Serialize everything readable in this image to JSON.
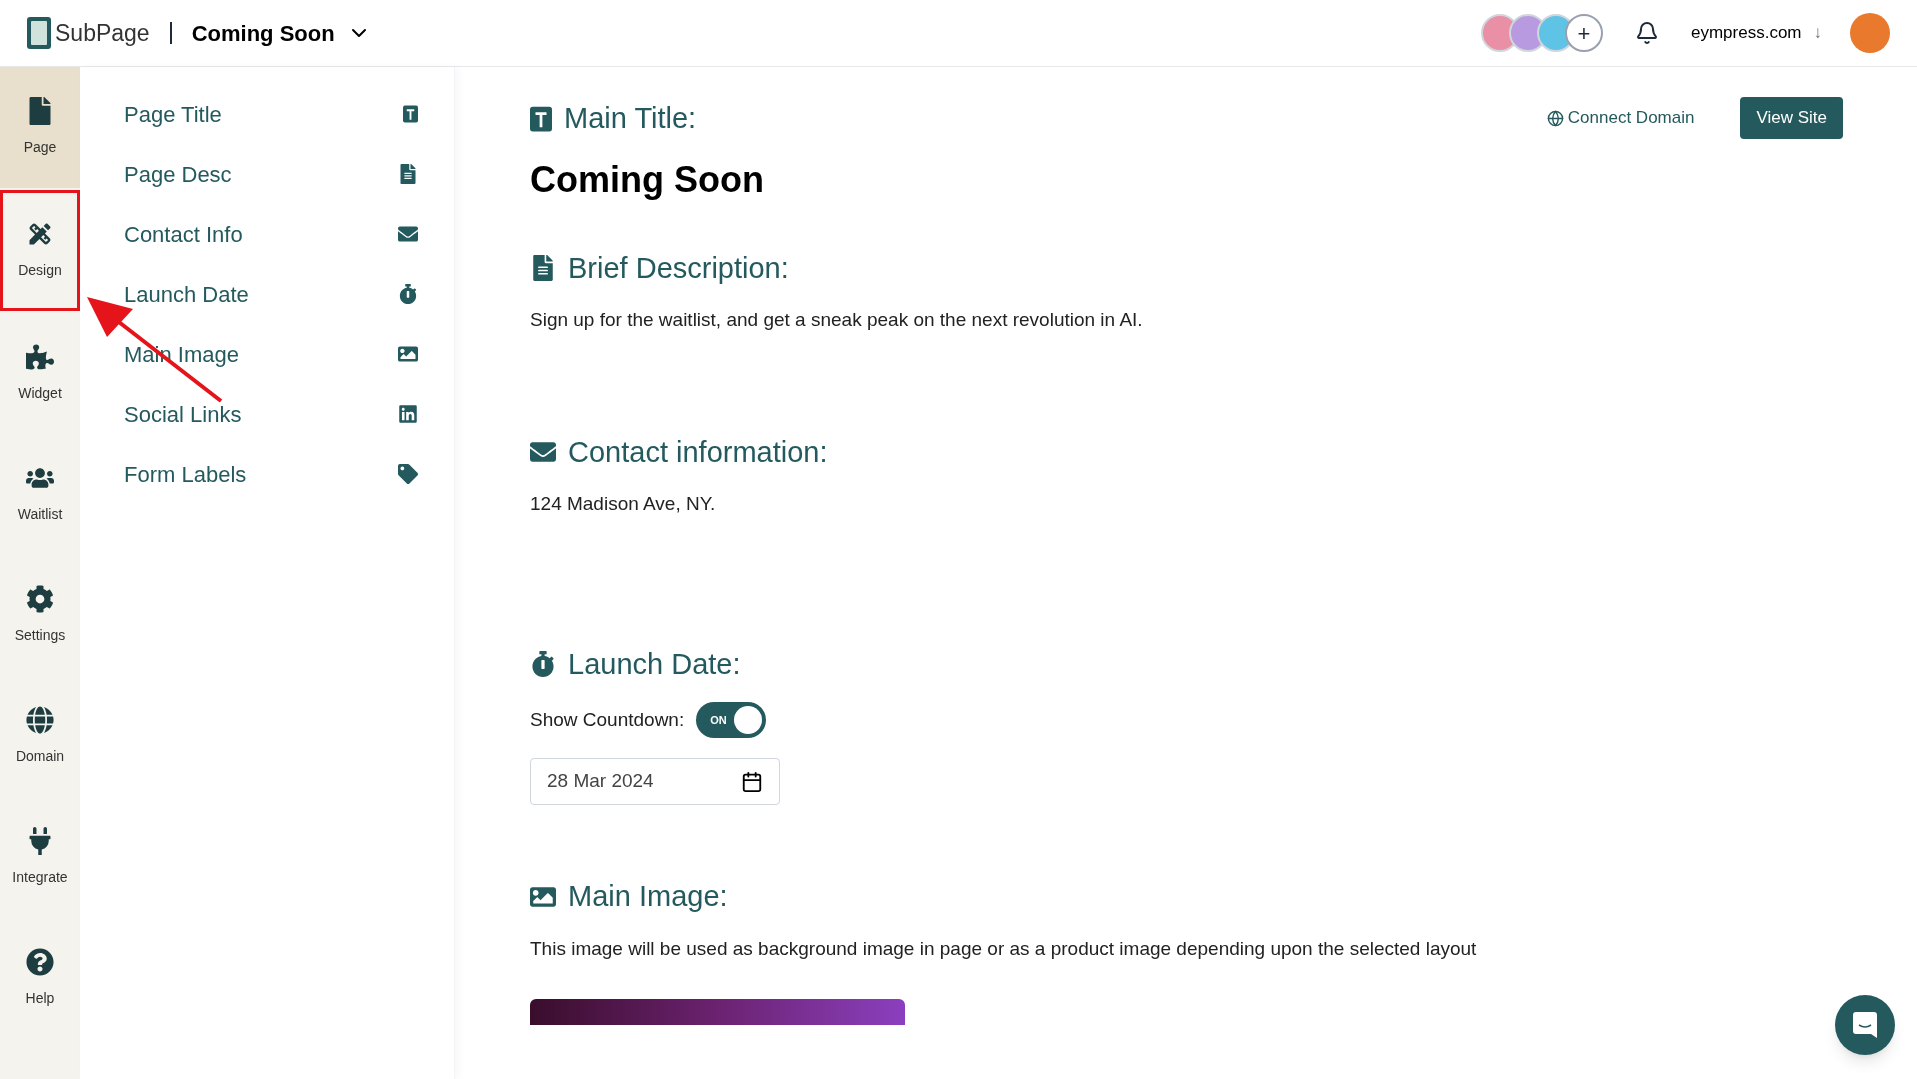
{
  "header": {
    "logo": "SubPage",
    "page_name": "Coming Soon",
    "domain": "eympress.com",
    "domain_arrow": "↓",
    "add_member": "+"
  },
  "rail": [
    {
      "label": "Page",
      "selected": true,
      "highlighted": false
    },
    {
      "label": "Design",
      "selected": false,
      "highlighted": true
    },
    {
      "label": "Widget",
      "selected": false,
      "highlighted": false
    },
    {
      "label": "Waitlist",
      "selected": false,
      "highlighted": false
    },
    {
      "label": "Settings",
      "selected": false,
      "highlighted": false
    },
    {
      "label": "Domain",
      "selected": false,
      "highlighted": false
    },
    {
      "label": "Integrate",
      "selected": false,
      "highlighted": false
    },
    {
      "label": "Help",
      "selected": false,
      "highlighted": false
    }
  ],
  "sections": [
    "Page Title",
    "Page Desc",
    "Contact Info",
    "Launch Date",
    "Main Image",
    "Social Links",
    "Form Labels"
  ],
  "actions": {
    "connect": "Connect Domain",
    "view": "View Site"
  },
  "main": {
    "title_label": "Main Title:",
    "title": "Coming Soon",
    "description_label": "Brief Description:",
    "description": "Sign up for the waitlist, and get a sneak peak on the next revolution in AI.",
    "contact_label": "Contact information:",
    "contact": "124 Madison Ave, NY.",
    "launch_label": "Launch Date:",
    "countdown_label": "Show Countdown:",
    "countdown": {
      "on": true,
      "on_text": "ON"
    },
    "date": "28 Mar 2024",
    "image_label": "Main Image:",
    "image_note": "This image will be used as background image in page or as a product image depending upon the selected layout"
  }
}
